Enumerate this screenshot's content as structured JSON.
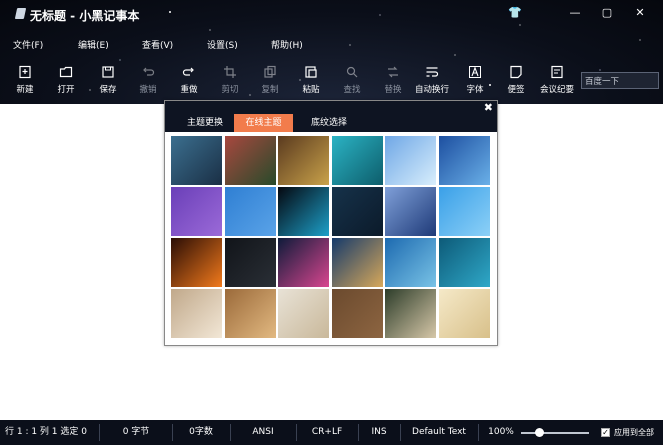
{
  "window": {
    "title": "无标题 - 小黑记事本"
  },
  "window_controls": {
    "skin": "👕",
    "minimize": "—",
    "maximize": "▢",
    "close": "✕"
  },
  "menu": [
    "文件(F)",
    "编辑(E)",
    "查看(V)",
    "设置(S)",
    "帮助(H)"
  ],
  "toolbar": [
    {
      "label": "新建",
      "icon": "new-file-icon",
      "enabled": true
    },
    {
      "label": "打开",
      "icon": "folder-open-icon",
      "enabled": true
    },
    {
      "label": "保存",
      "icon": "save-icon",
      "enabled": true
    },
    {
      "label": "撤销",
      "icon": "undo-icon",
      "enabled": false
    },
    {
      "label": "重做",
      "icon": "redo-icon",
      "enabled": true
    },
    {
      "label": "剪切",
      "icon": "cut-icon",
      "enabled": false
    },
    {
      "label": "复制",
      "icon": "copy-icon",
      "enabled": false
    },
    {
      "label": "粘贴",
      "icon": "paste-icon",
      "enabled": true
    },
    {
      "label": "查找",
      "icon": "find-icon",
      "enabled": false
    },
    {
      "label": "替换",
      "icon": "replace-icon",
      "enabled": false
    },
    {
      "label": "自动换行",
      "icon": "word-wrap-icon",
      "enabled": true
    },
    {
      "label": "字体",
      "icon": "font-icon",
      "enabled": true
    },
    {
      "label": "便签",
      "icon": "sticky-note-icon",
      "enabled": true
    },
    {
      "label": "会议纪要",
      "icon": "meeting-notes-icon",
      "enabled": true
    }
  ],
  "search": {
    "value": "百度一下"
  },
  "dialog": {
    "close": "✖",
    "tabs": [
      "主题更换",
      "在线主题",
      "底纹选择"
    ],
    "active_tab": 1,
    "thumbnails": [
      [
        "#3b6f8f",
        "#1a2f45"
      ],
      [
        "#a8483f",
        "#274a2a"
      ],
      [
        "#5a3a1f",
        "#c9a24a"
      ],
      [
        "#2bb3c4",
        "#0d5d6b"
      ],
      [
        "#6fa7e6",
        "#d8eefc"
      ],
      [
        "#1d4fa0",
        "#6ab0e8"
      ],
      [
        "#6a3fb8",
        "#9b6ad8"
      ],
      [
        "#2f7fd3",
        "#5aa3e8"
      ],
      [
        "#05070f",
        "#1da0c9"
      ],
      [
        "#16324a",
        "#0b1a2a"
      ],
      [
        "#7f9fd8",
        "#1e3a78"
      ],
      [
        "#3aa0e8",
        "#8cd0f7"
      ],
      [
        "#2a0d05",
        "#f27a1c"
      ],
      [
        "#111419",
        "#2a2f36"
      ],
      [
        "#0e1b3a",
        "#d9468f"
      ],
      [
        "#153a6b",
        "#d7a85a"
      ],
      [
        "#1d6ab0",
        "#79c3e6"
      ],
      [
        "#0d5a78",
        "#2fa8c8"
      ],
      [
        "#c0a88a",
        "#f2e7d6"
      ],
      [
        "#9b6a3a",
        "#e2b981"
      ],
      [
        "#e8e2d6",
        "#c9b89a"
      ],
      [
        "#6b4a2e",
        "#8d6541"
      ],
      [
        "#2d3d2a",
        "#d6c7a8"
      ],
      [
        "#f5e9c8",
        "#d8c08a"
      ]
    ]
  },
  "status": {
    "position": "行 1 : 1   列 1   选定 0",
    "bytes": "0 字节",
    "chars": "0字数",
    "encoding": "ANSI",
    "line_ending": "CR+LF",
    "insert_mode": "INS",
    "language": "Default Text",
    "zoom": "100%",
    "apply_all": "应用到全部"
  }
}
